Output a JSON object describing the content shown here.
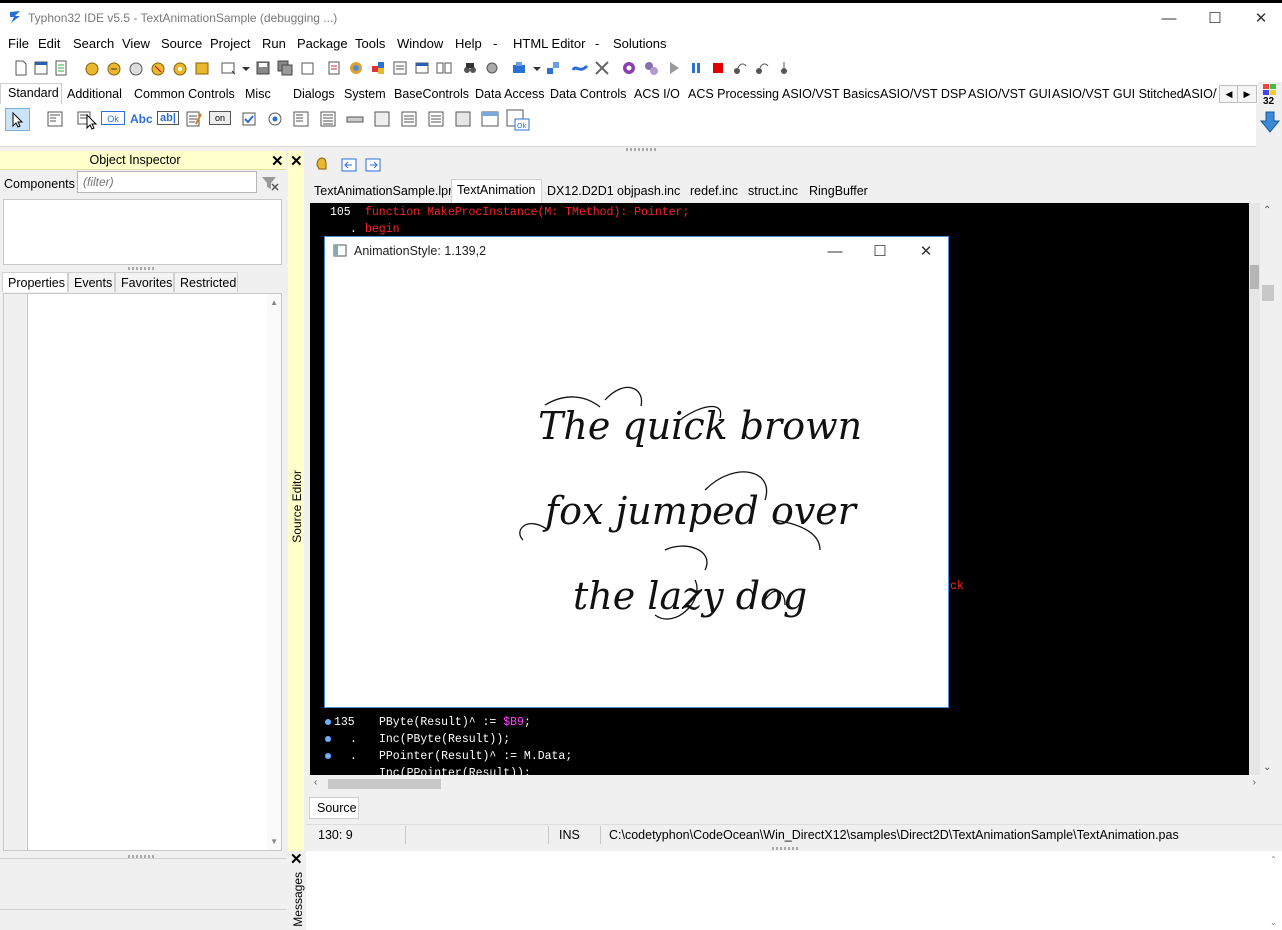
{
  "window": {
    "title": "Typhon32 IDE v5.5 - TextAnimationSample (debugging ...)",
    "minimize": "—",
    "maximize": "☐",
    "close": "✕"
  },
  "menu": [
    "File",
    "Edit",
    "Search",
    "View",
    "Source",
    "Project",
    "Run",
    "Package",
    "Tools",
    "Window",
    "Help",
    "-",
    "HTML Editor",
    "-",
    "Solutions"
  ],
  "palette": {
    "tabs": [
      "Standard",
      "Additional",
      "Common Controls",
      "Misc",
      "Dialogs",
      "System",
      "BaseControls",
      "Data Access",
      "Data Controls",
      "ACS I/O",
      "ACS Processing",
      "ASIO/VST Basics",
      "ASIO/VST DSP",
      "ASIO/VST GUI",
      "ASIO/VST GUI Stitched",
      "ASIO/\\"
    ],
    "size_label": "32",
    "component_labels": [
      "Ok",
      "Abc",
      "ab|",
      "on"
    ]
  },
  "object_inspector": {
    "title": "Object Inspector",
    "components_label": "Components",
    "filter_placeholder": "(filter)",
    "tabs": [
      "Properties",
      "Events",
      "Favorites",
      "Restricted"
    ],
    "side_label": "Source Editor",
    "close": "✕"
  },
  "editor": {
    "file_tabs": [
      "TextAnimationSample.lpr",
      "TextAnimation",
      "DX12.D2D1",
      "objpash.inc",
      "redef.inc",
      "struct.inc",
      "RingBuffer"
    ],
    "active_tab": "TextAnimation",
    "lines_top": [
      {
        "gutter": "105",
        "code": "function MakeProcInstance(M: TMethod): Pointer;"
      },
      {
        "gutter": ".",
        "code": "begin"
      }
    ],
    "fragment": "ck",
    "lines_bottom": [
      {
        "gutter": "135",
        "text_a": "PByte(Result)^ := ",
        "text_b": "$B9",
        "text_c": ";"
      },
      {
        "gutter": ".",
        "text_a": "Inc(PByte(Result));",
        "text_b": "",
        "text_c": ""
      },
      {
        "gutter": ".",
        "text_a": "PPointer(Result)^ := M.Data;",
        "text_b": "",
        "text_c": ""
      },
      {
        "gutter": "",
        "text_a": "Inc(PPointer(Result));",
        "text_b": "",
        "text_c": ""
      }
    ],
    "source_tab": "Source",
    "close": "✕"
  },
  "status": {
    "position": "130:  9",
    "mode": "INS",
    "path": "C:\\codetyphon\\CodeOcean\\Win_DirectX12\\samples\\Direct2D\\TextAnimationSample\\TextAnimation.pas"
  },
  "messages": {
    "label": "Messages",
    "close": "✕"
  },
  "animation_window": {
    "title": "AnimationStyle: 1.139,2",
    "lines": [
      "The quick brown",
      "fox jumped over",
      "the lazy dog"
    ],
    "minimize": "—",
    "maximize": "☐",
    "close": "✕"
  },
  "colors": {
    "code_red": "#ff2020",
    "code_magenta": "#ff40ff",
    "inspector_yellow": "#ffffcc",
    "accent_blue": "#4a90d9"
  }
}
